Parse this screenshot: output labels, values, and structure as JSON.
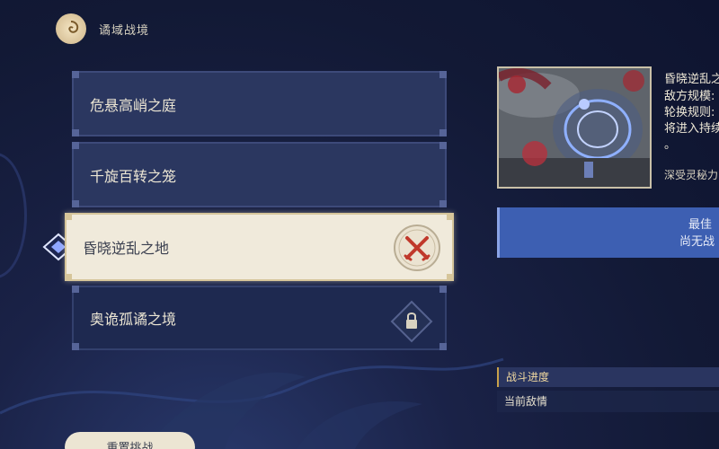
{
  "header": {
    "title": "谲域战境",
    "icon": "spiral-emblem-icon"
  },
  "levels": [
    {
      "label": "危悬高峭之庭",
      "state": "normal"
    },
    {
      "label": "千旋百转之笼",
      "state": "normal"
    },
    {
      "label": "昏晓逆乱之地",
      "state": "selected",
      "badge": "crossed-swords-icon"
    },
    {
      "label": "奥诡孤谲之境",
      "state": "locked",
      "badge": "lock-icon"
    }
  ],
  "reset_button": {
    "label": "重置挑战"
  },
  "detail": {
    "title": "昏晓逆乱之",
    "lines": [
      "敌方规模:",
      "轮换规则:",
      "将进入持续"
    ],
    "dot": "。",
    "extra": "深受灵秘力",
    "best_label": "最佳",
    "best_value": "尚无战",
    "progress_label": "战斗进度",
    "enemy_label": "当前敌情"
  },
  "colors": {
    "selected_bg": "#f0eadb",
    "level_bg": "#2b3760",
    "accent_blue": "#3d5fb2",
    "badge_red": "#c0392b"
  }
}
